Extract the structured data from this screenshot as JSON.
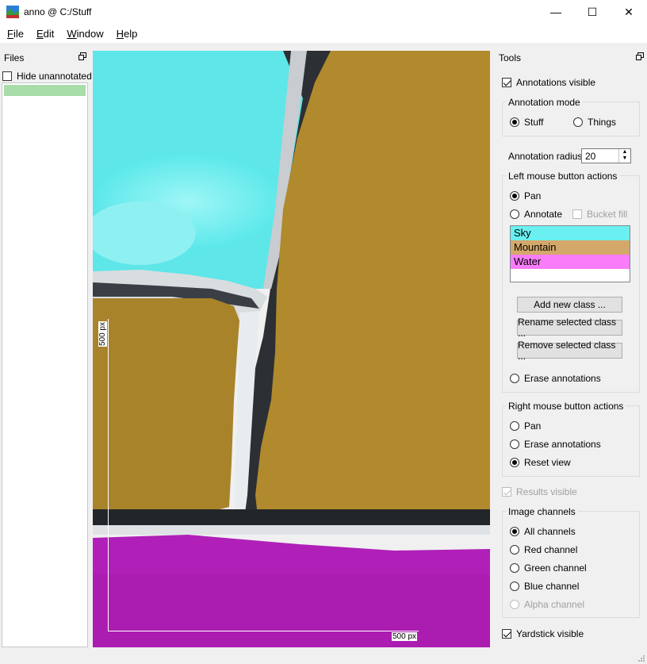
{
  "window": {
    "title": "anno @ C:/Stuff",
    "minimize": "—",
    "maximize": "☐",
    "close": "✕"
  },
  "menu": [
    {
      "label": "File",
      "mnemonic": "F",
      "rest": "ile"
    },
    {
      "label": "Edit",
      "mnemonic": "E",
      "rest": "dit"
    },
    {
      "label": "Window",
      "mnemonic": "W",
      "rest": "indow"
    },
    {
      "label": "Help",
      "mnemonic": "H",
      "rest": "elp"
    }
  ],
  "files_panel": {
    "title": "Files",
    "hide_unannotated": {
      "label": "Hide unannotated",
      "checked": false
    }
  },
  "tools_panel": {
    "title": "Tools",
    "annotations_visible": {
      "label": "Annotations visible",
      "checked": true
    },
    "annotation_mode": {
      "title": "Annotation mode",
      "stuff": "Stuff",
      "things": "Things",
      "selected": "Stuff"
    },
    "annotation_radius": {
      "label": "Annotation radius",
      "value": "20"
    },
    "left_mouse": {
      "title": "Left mouse button actions",
      "pan": "Pan",
      "annotate": "Annotate",
      "bucket_fill": "Bucket fill",
      "selected": "Pan",
      "classes": [
        {
          "name": "Sky",
          "color": "#6af0f0"
        },
        {
          "name": "Mountain",
          "color": "#d4a86a"
        },
        {
          "name": "Water",
          "color": "#f97cf9"
        }
      ],
      "add_class": "Add new class ...",
      "rename_class": "Rename selected class ...",
      "remove_class": "Remove selected class ...",
      "erase": "Erase annotations"
    },
    "right_mouse": {
      "title": "Right mouse button actions",
      "pan": "Pan",
      "erase": "Erase annotations",
      "reset": "Reset view",
      "selected": "Reset view"
    },
    "results_visible": {
      "label": "Results visible",
      "checked": true,
      "disabled": true
    },
    "image_channels": {
      "title": "Image channels",
      "all": "All channels",
      "red": "Red channel",
      "green": "Green channel",
      "blue": "Blue channel",
      "alpha": "Alpha channel",
      "selected": "All channels"
    },
    "yardstick_visible": {
      "label": "Yardstick visible",
      "checked": true
    }
  },
  "canvas": {
    "yardstick_vertical": "500 px",
    "yardstick_horizontal": "500 px"
  }
}
